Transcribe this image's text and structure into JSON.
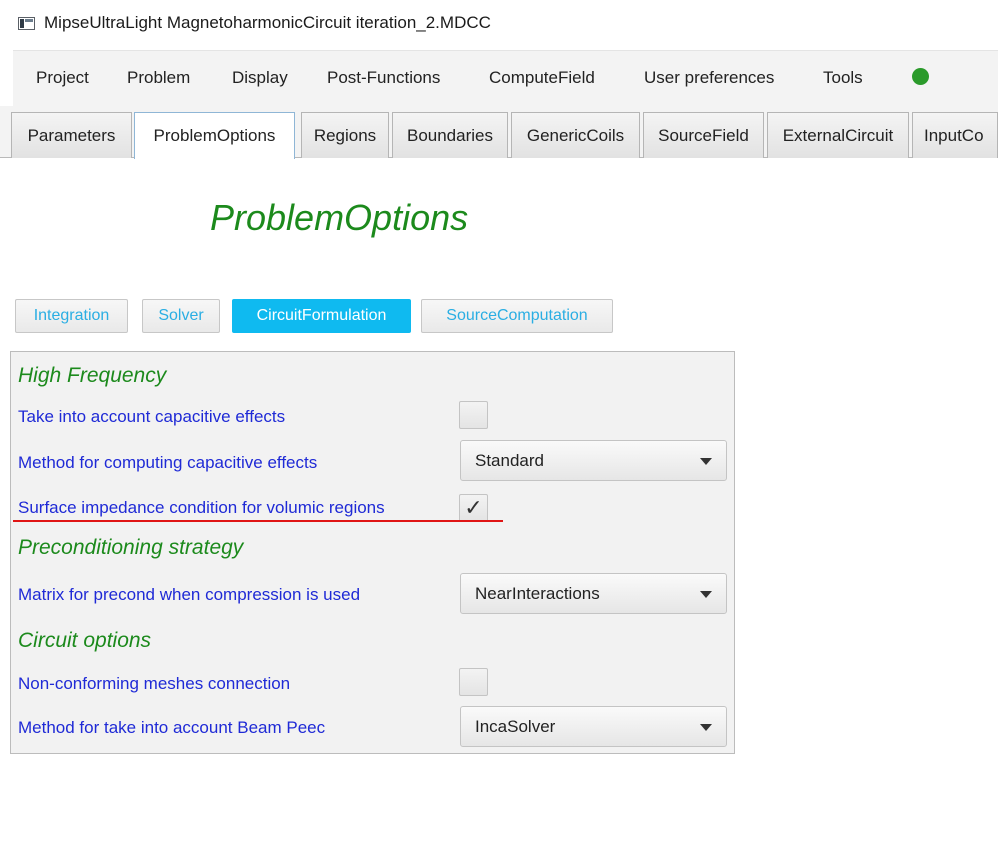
{
  "window": {
    "title": "MipseUltraLight MagnetoharmonicCircuit iteration_2.MDCC"
  },
  "menu": {
    "items": [
      "Project",
      "Problem",
      "Display",
      "Post-Functions",
      "ComputeField",
      "User preferences",
      "Tools"
    ],
    "status_color": "#2a9a2a"
  },
  "tabs": {
    "items": [
      "Parameters",
      "ProblemOptions",
      "Regions",
      "Boundaries",
      "GenericCoils",
      "SourceField",
      "ExternalCircuit",
      "InputCo"
    ],
    "active": "ProblemOptions"
  },
  "page": {
    "heading": "ProblemOptions"
  },
  "subtabs": {
    "items": [
      "Integration",
      "Solver",
      "CircuitFormulation",
      "SourceComputation"
    ],
    "selected": "CircuitFormulation",
    "accent_color": "#0fbaf0"
  },
  "panel": {
    "sections": {
      "high_frequency": "High Frequency",
      "preconditioning": "Preconditioning strategy",
      "circuit_options": "Circuit options"
    },
    "rows": {
      "capacitive_effects": {
        "label": "Take into account capacitive effects",
        "checked": false
      },
      "capacitive_method": {
        "label": "Method for computing capacitive effects",
        "value": "Standard"
      },
      "surface_impedance": {
        "label": "Surface impedance condition for volumic regions",
        "checked": true,
        "check_glyph": "✓"
      },
      "precond_matrix": {
        "label": "Matrix for precond when compression is used",
        "value": "NearInteractions"
      },
      "nonconforming": {
        "label": "Non-conforming meshes connection",
        "checked": false
      },
      "beam_peec": {
        "label": "Method for take into account Beam Peec",
        "value": "IncaSolver"
      }
    },
    "label_color": "#1f2ad6",
    "section_color": "#1c8a1c",
    "highlight_color": "#e01515"
  }
}
